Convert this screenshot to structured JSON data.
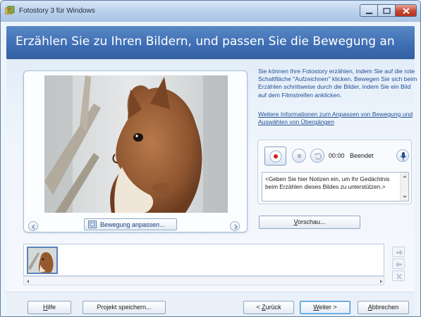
{
  "window": {
    "title": "Fotostory 3 für Windows",
    "controls": {
      "minimize": "minimize-icon",
      "maximize": "maximize-icon",
      "close": "close-icon"
    }
  },
  "header": {
    "title": "Erzählen Sie zu Ihren Bildern, und passen Sie die Bewegung an"
  },
  "preview": {
    "motion_button_label": "Bewegung anpassen...",
    "image_subject": "Eichhörnchen"
  },
  "info": {
    "text": "Sie können Ihre Fotostory erzählen, indem Sie auf die rote Schaltfläche \"Aufzeichnen\" klicken. Bewegen Sie sich beim Erzählen schrittweise durch die Bilder, indem Sie ein Bild auf dem Filmstreifen anklicken.",
    "link": "Weitere Informationen zum Anpassen von Bewegung und Auswählen von Übergängen"
  },
  "recorder": {
    "time": "00:00",
    "status": "Beendet",
    "notes": "<Geben Sie hier Notizen ein, um Ihr Gedächtnis beim Erzählen dieses Bildes zu unterstützen.>"
  },
  "preview_button": {
    "label_underlined": "V",
    "label_rest": "orschau..."
  },
  "footer": {
    "help": {
      "u": "H",
      "rest": "ilfe"
    },
    "save_project": "Projekt speichern...",
    "back": {
      "pre": "< ",
      "u": "Z",
      "rest": "urück"
    },
    "next": {
      "u": "W",
      "rest": "eiter >"
    },
    "cancel": {
      "u": "A",
      "rest": "bbrechen"
    }
  },
  "colors": {
    "header_bg": "#3d6db3",
    "record_red": "#d21f1f",
    "link_blue": "#1f4f95"
  }
}
